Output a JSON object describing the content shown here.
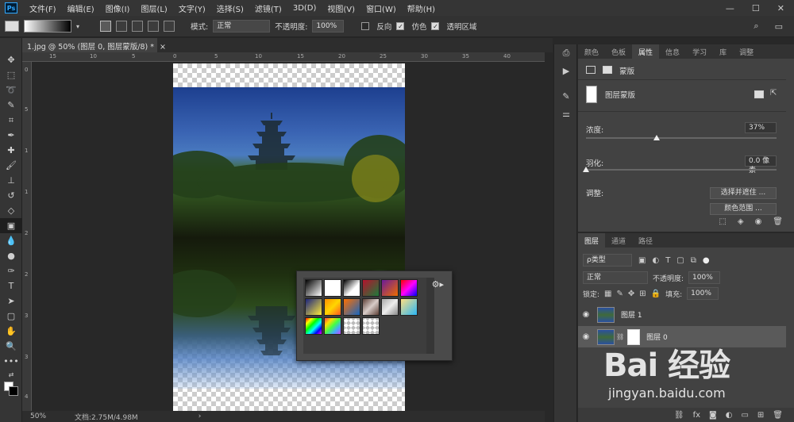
{
  "menubar": {
    "logo": "Ps",
    "items": [
      "文件(F)",
      "编辑(E)",
      "图像(I)",
      "图层(L)",
      "文字(Y)",
      "选择(S)",
      "滤镜(T)",
      "3D(D)",
      "视图(V)",
      "窗口(W)",
      "帮助(H)"
    ],
    "win_min": "—",
    "win_max": "☐",
    "win_close": "✕"
  },
  "options": {
    "mode_label": "模式:",
    "mode_value": "正常",
    "opacity_label": "不透明度:",
    "opacity_value": "100%",
    "reverse_label": "反向",
    "dither_label": "仿色",
    "transparency_label": "透明区域"
  },
  "document": {
    "tab_title": "1.jpg @ 50% (图层 0, 图层蒙版/8) *",
    "close": "×"
  },
  "ruler_h": [
    "15",
    "10",
    "5",
    "0",
    "5",
    "10",
    "15",
    "20",
    "25",
    "30",
    "35",
    "40"
  ],
  "ruler_v": [
    "0",
    "5",
    "1",
    "1",
    "2",
    "2",
    "3",
    "3",
    "4"
  ],
  "status": {
    "zoom": "50%",
    "doc_info": "文档:2.75M/4.98M",
    "arrow": "›"
  },
  "properties": {
    "tabs": [
      "颜色",
      "色板",
      "属性",
      "信息",
      "学习",
      "库",
      "调整"
    ],
    "active_tab": 2,
    "mask_header": "蒙版",
    "mask_type": "图层蒙版",
    "density_label": "浓度:",
    "density_value": "37%",
    "density_level": 0.37,
    "feather_label": "羽化:",
    "feather_value": "0.0 像素",
    "feather_level": 0,
    "adjust_label": "调整:",
    "btn_select_mask": "选择并遮住 ...",
    "btn_color_range": "颜色范围 ..."
  },
  "layers": {
    "tabs": [
      "图层",
      "通道",
      "路径"
    ],
    "filter_kind": "ρ类型",
    "blend_mode": "正常",
    "opacity_label": "不透明度:",
    "opacity_value": "100%",
    "lock_label": "锁定:",
    "fill_label": "填充:",
    "fill_value": "100%",
    "items": [
      {
        "name": "图层 1",
        "selected": false
      },
      {
        "name": "图层 0",
        "selected": true
      }
    ]
  },
  "watermark": {
    "logo": "Bai 经验",
    "url": "jingyan.baidu.com"
  },
  "gradient_swatches": [
    "linear-gradient(135deg,#000,#fff)",
    "linear-gradient(135deg,#fff,#fff)",
    "linear-gradient(135deg,#000,#fff 60%,#fff)",
    "linear-gradient(135deg,#b5132d,#1d7a3a)",
    "linear-gradient(135deg,#6a1b9a,#ef6c00)",
    "linear-gradient(135deg,#ff0000,#ff00ff,#0000ff)",
    "linear-gradient(135deg,#1a237e,#ffeb3b)",
    "linear-gradient(135deg,#ff8f00,#ffd600,#ff5722)",
    "linear-gradient(135deg,#ff6f00,#1565c0)",
    "linear-gradient(135deg,#5d4037,#d7ccc8,#5d4037)",
    "linear-gradient(135deg,#aaa,#eee,#888)",
    "linear-gradient(135deg,#ffe082,#29b6f6)",
    "linear-gradient(135deg,#f00,#ff0,#0f0,#0ff,#00f,#f0f)",
    "linear-gradient(135deg,#f44,#fd0,#4f4,#4af,#c4f)",
    "linear-gradient(135deg,#eee,#ccc)",
    "linear-gradient(135deg,#ddd,#bbb)"
  ]
}
